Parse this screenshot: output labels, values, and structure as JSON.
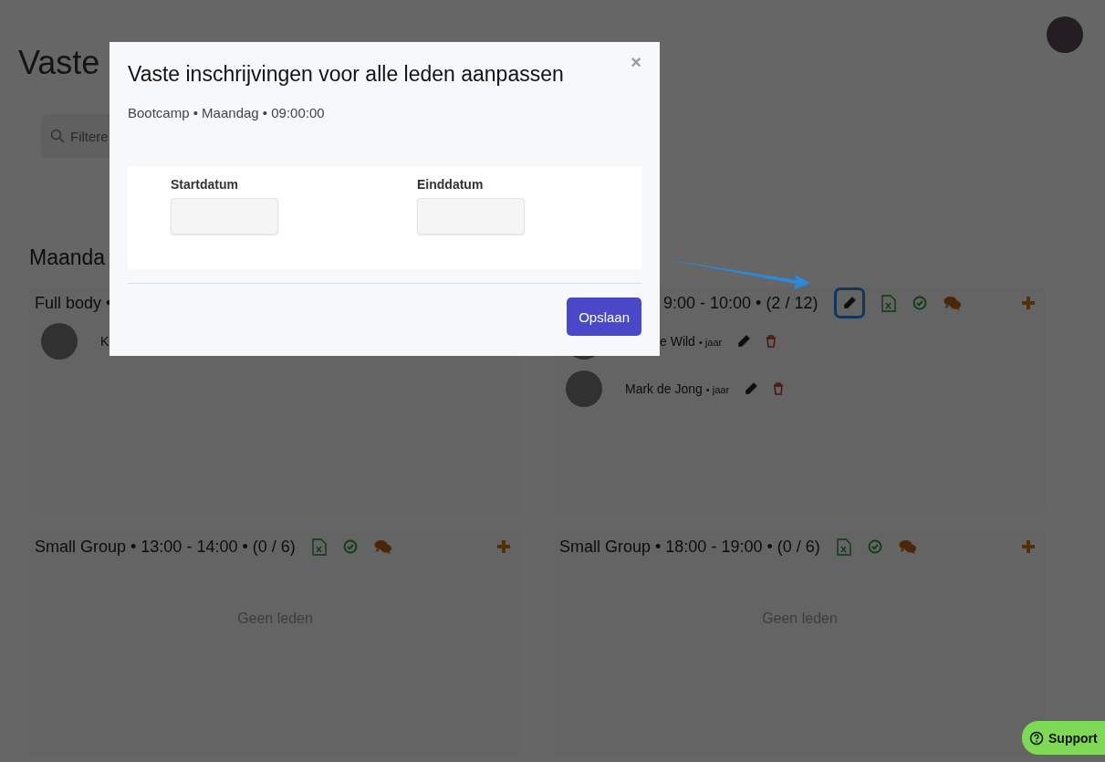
{
  "page": {
    "title": "Vaste",
    "search": {
      "placeholder": "Filtere"
    },
    "day_heading": "Maanda",
    "sessions": [
      {
        "kind": "full",
        "title": "Full body •",
        "add": false,
        "members": [
          {
            "kind": "full",
            "name": "K"
          }
        ]
      },
      {
        "kind": "clipped",
        "title": "9:00 - 10:00 • (2 / 12)",
        "actions": [
          {
            "kind": "edit",
            "highlighted": true
          },
          {
            "kind": "excel",
            "highlighted": false
          },
          {
            "kind": "check",
            "highlighted": false
          },
          {
            "kind": "chat",
            "highlighted": false
          }
        ],
        "add": true,
        "members": [
          {
            "kind": "clipped",
            "name": "e Wild",
            "suffix": "• jaar",
            "actions": [
              {
                "kind": "edit"
              },
              {
                "kind": "delete"
              }
            ]
          },
          {
            "kind": "full",
            "name": "Mark de Jong",
            "suffix": "• jaar",
            "actions": [
              {
                "kind": "edit"
              },
              {
                "kind": "delete"
              }
            ]
          }
        ]
      },
      {
        "kind": "full",
        "title": "Small Group • 13:00 - 14:00 • (0 / 6)",
        "actions": [
          {
            "kind": "excel",
            "highlighted": false
          },
          {
            "kind": "check",
            "highlighted": false
          },
          {
            "kind": "chat",
            "highlighted": false
          }
        ],
        "add": true,
        "empty_text": "Geen leden"
      },
      {
        "kind": "full",
        "title": "Small Group • 18:00 - 19:00 • (0 / 6)",
        "actions": [
          {
            "kind": "excel",
            "highlighted": false
          },
          {
            "kind": "check",
            "highlighted": false
          },
          {
            "kind": "chat",
            "highlighted": false
          }
        ],
        "add": true,
        "empty_text": "Geen leden"
      }
    ]
  },
  "modal": {
    "title": "Vaste inschrijvingen voor alle leden aanpassen",
    "close": "×",
    "subtitle": "Bootcamp • Maandag • 09:00:00",
    "fields": [
      {
        "label": "Startdatum"
      },
      {
        "label": "Einddatum"
      }
    ],
    "button": "Opslaan"
  },
  "support_button": {
    "label": "Support"
  }
}
